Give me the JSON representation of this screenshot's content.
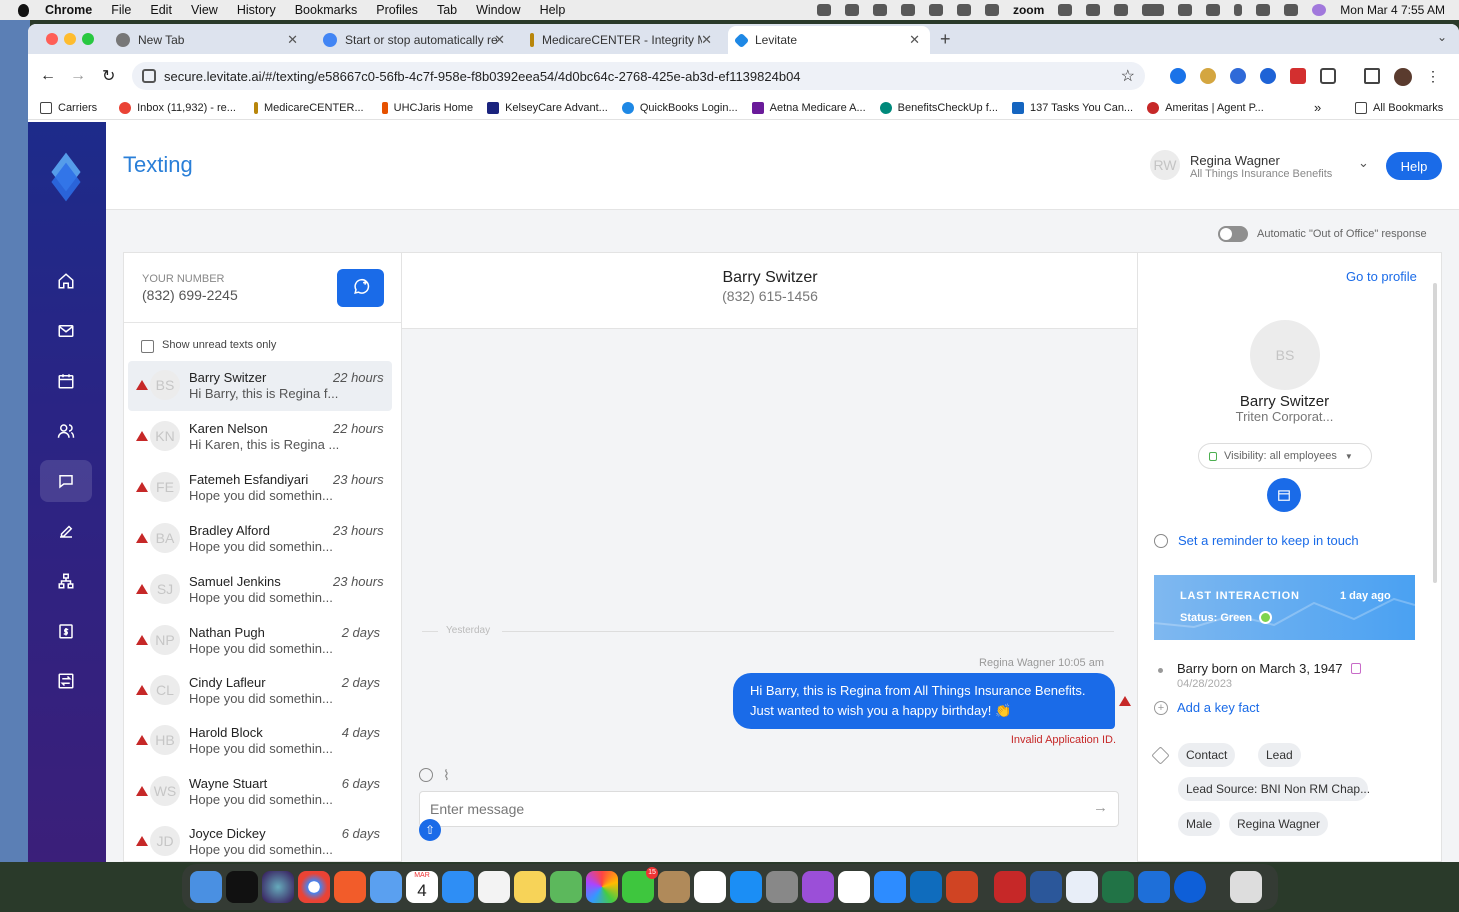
{
  "menubar": {
    "apple": "",
    "app": "Chrome",
    "items": [
      "File",
      "Edit",
      "View",
      "History",
      "Bookmarks",
      "Profiles",
      "Tab",
      "Window",
      "Help"
    ],
    "zoom": "zoom",
    "clock": "Mon Mar 4  7:55 AM"
  },
  "tabs": [
    {
      "label": "New Tab",
      "color": "#555"
    },
    {
      "label": "Start or stop automatically re",
      "color": "#4285f4"
    },
    {
      "label": "MedicareCENTER - Integrity M",
      "color": "#b8860b"
    },
    {
      "label": "Levitate",
      "color": "#1e88e5"
    }
  ],
  "url": "secure.levitate.ai/#/texting/e58667c0-56fb-4c7f-958e-f8b0392eea54/4d0bc64c-2768-425e-ab3d-ef1139824b04",
  "bookmarks": [
    {
      "label": "Carriers",
      "color": "#555"
    },
    {
      "label": "Inbox (11,932) - re...",
      "color": "#ea4335"
    },
    {
      "label": "MedicareCENTER...",
      "color": "#b8860b"
    },
    {
      "label": "UHCJaris Home",
      "color": "#e65100"
    },
    {
      "label": "KelseyCare Advant...",
      "color": "#1a237e"
    },
    {
      "label": "QuickBooks Login...",
      "color": "#1e88e5"
    },
    {
      "label": "Aetna Medicare A...",
      "color": "#6a1b9a"
    },
    {
      "label": "BenefitsCheckUp f...",
      "color": "#00897b"
    },
    {
      "label": "137 Tasks You Can...",
      "color": "#1565c0"
    },
    {
      "label": "Ameritas | Agent P...",
      "color": "#c62828"
    }
  ],
  "all_bookmarks": "All Bookmarks",
  "app": {
    "title": "Texting",
    "user": {
      "initials": "RW",
      "name": "Regina Wagner",
      "company": "All Things Insurance Benefits"
    },
    "help": "Help",
    "ooo": "Automatic \"Out of Office\" response"
  },
  "list": {
    "your_number_label": "YOUR NUMBER",
    "your_number": "(832) 699-2245",
    "unread_label": "Show unread texts only",
    "contacts": [
      {
        "initials": "BS",
        "name": "Barry Switzer",
        "preview": "Hi Barry, this is Regina f...",
        "time": "22 hours"
      },
      {
        "initials": "KN",
        "name": "Karen Nelson",
        "preview": "Hi Karen, this is Regina ...",
        "time": "22 hours"
      },
      {
        "initials": "FE",
        "name": "Fatemeh Esfandiyari",
        "preview": "Hope you did somethin...",
        "time": "23 hours"
      },
      {
        "initials": "BA",
        "name": "Bradley Alford",
        "preview": "Hope you did somethin...",
        "time": "23 hours"
      },
      {
        "initials": "SJ",
        "name": "Samuel Jenkins",
        "preview": "Hope you did somethin...",
        "time": "23 hours"
      },
      {
        "initials": "NP",
        "name": "Nathan Pugh",
        "preview": "Hope you did somethin...",
        "time": "2 days"
      },
      {
        "initials": "CL",
        "name": "Cindy Lafleur",
        "preview": "Hope you did somethin...",
        "time": "2 days"
      },
      {
        "initials": "HB",
        "name": "Harold Block",
        "preview": "Hope you did somethin...",
        "time": "4 days"
      },
      {
        "initials": "WS",
        "name": "Wayne Stuart",
        "preview": "Hope you did somethin...",
        "time": "6 days"
      },
      {
        "initials": "JD",
        "name": "Joyce Dickey",
        "preview": "Hope you did somethin...",
        "time": "6 days"
      }
    ]
  },
  "chat": {
    "name": "Barry Switzer",
    "phone": "(832) 615-1456",
    "divider": "Yesterday",
    "meta": "Regina Wagner 10:05 am",
    "message": "Hi Barry, this is Regina from All Things Insurance Benefits. Just wanted to wish you a happy birthday! 👏",
    "error": "Invalid Application ID.",
    "placeholder": "Enter message"
  },
  "profile": {
    "go": "Go to profile",
    "initials": "BS",
    "name": "Barry Switzer",
    "company": "Triten Corporat...",
    "visibility": "Visibility: all employees",
    "reminder": "Set a reminder to keep in touch",
    "last_label": "LAST INTERACTION",
    "last_value": "1 day ago",
    "status": "Status: Green",
    "fact": "Barry born on March 3, 1947",
    "fact_date": "04/28/2023",
    "add_fact": "Add a key fact",
    "tags": [
      "Contact",
      "Lead",
      "Lead Source: BNI Non RM Chap...",
      "Male",
      "Regina Wagner"
    ]
  },
  "dock_date": {
    "month": "MAR",
    "day": "4"
  },
  "dock_badge": "15"
}
